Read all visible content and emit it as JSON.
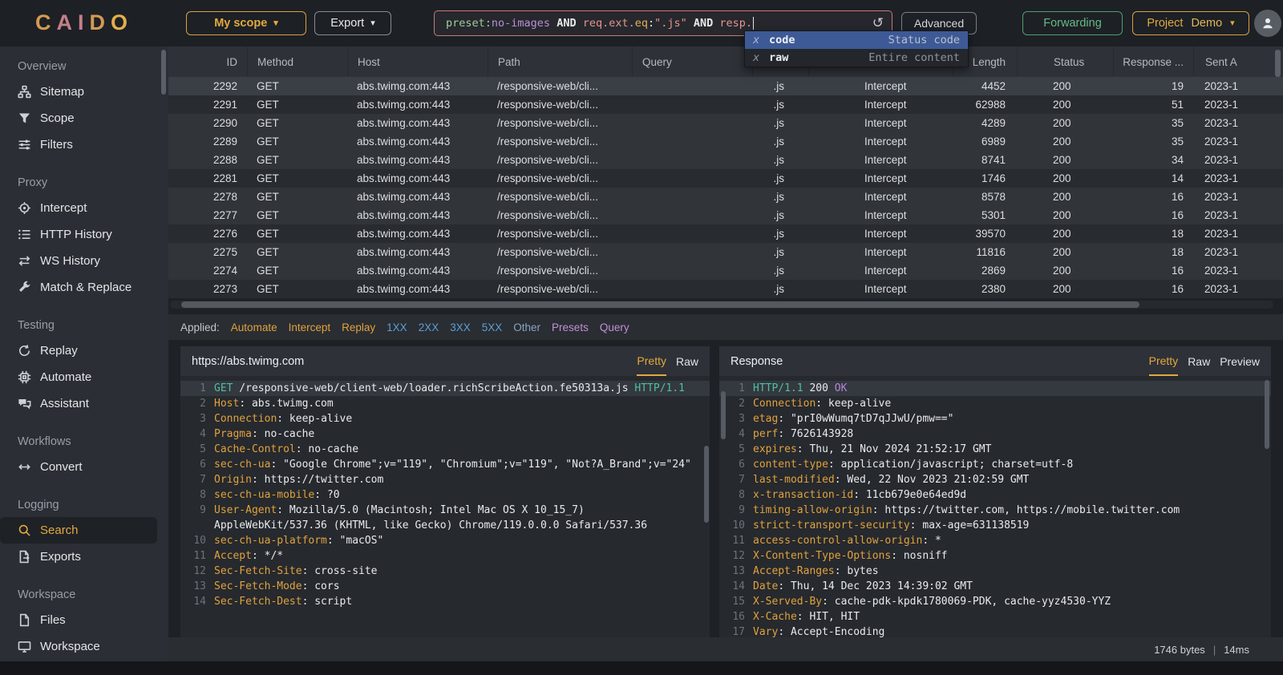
{
  "topbar": {
    "logo_letters": [
      {
        "ch": "C",
        "color": "#d49a52"
      },
      {
        "ch": "A",
        "color": "#c57f88"
      },
      {
        "ch": "I",
        "color": "#c57f88"
      },
      {
        "ch": "D",
        "color": "#d49a52"
      },
      {
        "ch": "O",
        "color": "#e4af49"
      }
    ],
    "scope_button": "My scope",
    "export_button": "Export",
    "search": {
      "segments": [
        {
          "text": "preset:",
          "color": "#9fcf9a"
        },
        {
          "text": "no-images",
          "color": "#b990d8"
        },
        {
          "text": " AND ",
          "color": "#e8e8e8",
          "bold": true
        },
        {
          "text": "req.ext.",
          "color": "#e8938f"
        },
        {
          "text": "eq",
          "color": "#e0b055"
        },
        {
          "text": ":",
          "color": "#e8e8e8"
        },
        {
          "text": "\".js\"",
          "color": "#e8938f"
        },
        {
          "text": " AND ",
          "color": "#e8e8e8",
          "bold": true
        },
        {
          "text": "resp.",
          "color": "#e8938f"
        }
      ],
      "advanced_button": "Advanced"
    },
    "autocomplete": [
      {
        "prefix": "x",
        "label": "code",
        "hint": "Status code",
        "selected": true
      },
      {
        "prefix": "x",
        "label": "raw",
        "hint": "Entire content",
        "selected": false
      }
    ],
    "forwarding_button": "Forwarding",
    "project_label": "Project",
    "project_name": "Demo"
  },
  "sidebar": {
    "sections": [
      {
        "label": "Overview",
        "items": [
          {
            "icon": "sitemap-icon",
            "label": "Sitemap"
          },
          {
            "icon": "funnel-icon",
            "label": "Scope"
          },
          {
            "icon": "sliders-icon",
            "label": "Filters"
          }
        ]
      },
      {
        "label": "Proxy",
        "items": [
          {
            "icon": "target-icon",
            "label": "Intercept"
          },
          {
            "icon": "list-icon",
            "label": "HTTP History"
          },
          {
            "icon": "swap-icon",
            "label": "WS History"
          },
          {
            "icon": "wrench-icon",
            "label": "Match & Replace"
          }
        ]
      },
      {
        "label": "Testing",
        "items": [
          {
            "icon": "refresh-icon",
            "label": "Replay"
          },
          {
            "icon": "chip-icon",
            "label": "Automate"
          },
          {
            "icon": "chat-icon",
            "label": "Assistant"
          }
        ]
      },
      {
        "label": "Workflows",
        "items": [
          {
            "icon": "convert-icon",
            "label": "Convert"
          }
        ]
      },
      {
        "label": "Logging",
        "items": [
          {
            "icon": "search-icon",
            "label": "Search",
            "active": true
          },
          {
            "icon": "export-icon",
            "label": "Exports"
          }
        ]
      },
      {
        "label": "Workspace",
        "items": [
          {
            "icon": "file-icon",
            "label": "Files"
          },
          {
            "icon": "monitor-icon",
            "label": "Workspace"
          }
        ]
      }
    ]
  },
  "table": {
    "columns": [
      "ID",
      "Method",
      "Host",
      "Path",
      "Query",
      "",
      "",
      "Length",
      "Status",
      "Response ...",
      "Sent A"
    ],
    "row_shades": [
      "bright",
      "dark",
      "light",
      "light",
      "light",
      "dark",
      "light",
      "light",
      "dark",
      "light",
      "light",
      "dark"
    ],
    "rows": [
      [
        "2292",
        "GET",
        "abs.twimg.com:443",
        "/responsive-web/cli...",
        "",
        ".js",
        "Intercept",
        "4452",
        "200",
        "19",
        "2023-1"
      ],
      [
        "2291",
        "GET",
        "abs.twimg.com:443",
        "/responsive-web/cli...",
        "",
        ".js",
        "Intercept",
        "62988",
        "200",
        "51",
        "2023-1"
      ],
      [
        "2290",
        "GET",
        "abs.twimg.com:443",
        "/responsive-web/cli...",
        "",
        ".js",
        "Intercept",
        "4289",
        "200",
        "35",
        "2023-1"
      ],
      [
        "2289",
        "GET",
        "abs.twimg.com:443",
        "/responsive-web/cli...",
        "",
        ".js",
        "Intercept",
        "6989",
        "200",
        "35",
        "2023-1"
      ],
      [
        "2288",
        "GET",
        "abs.twimg.com:443",
        "/responsive-web/cli...",
        "",
        ".js",
        "Intercept",
        "8741",
        "200",
        "34",
        "2023-1"
      ],
      [
        "2281",
        "GET",
        "abs.twimg.com:443",
        "/responsive-web/cli...",
        "",
        ".js",
        "Intercept",
        "1746",
        "200",
        "14",
        "2023-1"
      ],
      [
        "2278",
        "GET",
        "abs.twimg.com:443",
        "/responsive-web/cli...",
        "",
        ".js",
        "Intercept",
        "8578",
        "200",
        "16",
        "2023-1"
      ],
      [
        "2277",
        "GET",
        "abs.twimg.com:443",
        "/responsive-web/cli...",
        "",
        ".js",
        "Intercept",
        "5301",
        "200",
        "16",
        "2023-1"
      ],
      [
        "2276",
        "GET",
        "abs.twimg.com:443",
        "/responsive-web/cli...",
        "",
        ".js",
        "Intercept",
        "39570",
        "200",
        "18",
        "2023-1"
      ],
      [
        "2275",
        "GET",
        "abs.twimg.com:443",
        "/responsive-web/cli...",
        "",
        ".js",
        "Intercept",
        "11816",
        "200",
        "18",
        "2023-1"
      ],
      [
        "2274",
        "GET",
        "abs.twimg.com:443",
        "/responsive-web/cli...",
        "",
        ".js",
        "Intercept",
        "2869",
        "200",
        "16",
        "2023-1"
      ],
      [
        "2273",
        "GET",
        "abs.twimg.com:443",
        "/responsive-web/cli...",
        "",
        ".js",
        "Intercept",
        "2380",
        "200",
        "16",
        "2023-1"
      ]
    ]
  },
  "applied": {
    "label": "Applied:",
    "chips": [
      {
        "label": "Automate",
        "color": "#e0a23c"
      },
      {
        "label": "Intercept",
        "color": "#e0a23c"
      },
      {
        "label": "Replay",
        "color": "#e0a23c"
      },
      {
        "label": "1XX",
        "color": "#5b9fd8"
      },
      {
        "label": "2XX",
        "color": "#5b9fd8"
      },
      {
        "label": "3XX",
        "color": "#5b9fd8"
      },
      {
        "label": "5XX",
        "color": "#5b9fd8"
      },
      {
        "label": "Other",
        "color": "#87a5c2"
      },
      {
        "label": "Presets",
        "color": "#c08fd8"
      },
      {
        "label": "Query",
        "color": "#c08fd8"
      }
    ]
  },
  "request_panel": {
    "title": "https://abs.twimg.com",
    "tabs": [
      {
        "label": "Pretty",
        "active": true
      },
      {
        "label": "Raw",
        "active": false
      }
    ],
    "lines": [
      {
        "n": 1,
        "hl": true,
        "seg": [
          [
            "p",
            "GET"
          ],
          [
            "v",
            " /responsive-web/client-web/loader.richScribeAction.fe50313a.js "
          ],
          [
            "p",
            "HTTP/1.1"
          ]
        ]
      },
      {
        "n": 2,
        "seg": [
          [
            "k",
            "Host"
          ],
          [
            "v",
            ": abs.twimg.com"
          ]
        ]
      },
      {
        "n": 3,
        "seg": [
          [
            "k",
            "Connection"
          ],
          [
            "v",
            ": keep-alive"
          ]
        ]
      },
      {
        "n": 4,
        "seg": [
          [
            "k",
            "Pragma"
          ],
          [
            "v",
            ": no-cache"
          ]
        ]
      },
      {
        "n": 5,
        "seg": [
          [
            "k",
            "Cache-Control"
          ],
          [
            "v",
            ": no-cache"
          ]
        ]
      },
      {
        "n": 6,
        "seg": [
          [
            "k",
            "sec-ch-ua"
          ],
          [
            "v",
            ": \"Google Chrome\";v=\"119\", \"Chromium\";v=\"119\", \"Not?A_Brand\";v=\"24\""
          ]
        ]
      },
      {
        "n": 7,
        "seg": [
          [
            "k",
            "Origin"
          ],
          [
            "v",
            ": https://twitter.com"
          ]
        ]
      },
      {
        "n": 8,
        "seg": [
          [
            "k",
            "sec-ch-ua-mobile"
          ],
          [
            "v",
            ": ?0"
          ]
        ]
      },
      {
        "n": 9,
        "seg": [
          [
            "k",
            "User-Agent"
          ],
          [
            "v",
            ": Mozilla/5.0 (Macintosh; Intel Mac OS X 10_15_7) AppleWebKit/537.36 (KHTML, like Gecko) Chrome/119.0.0.0 Safari/537.36"
          ]
        ]
      },
      {
        "n": 10,
        "seg": [
          [
            "k",
            "sec-ch-ua-platform"
          ],
          [
            "v",
            ": \"macOS\""
          ]
        ]
      },
      {
        "n": 11,
        "seg": [
          [
            "k",
            "Accept"
          ],
          [
            "v",
            ": */*"
          ]
        ]
      },
      {
        "n": 12,
        "seg": [
          [
            "k",
            "Sec-Fetch-Site"
          ],
          [
            "v",
            ": cross-site"
          ]
        ]
      },
      {
        "n": 13,
        "seg": [
          [
            "k",
            "Sec-Fetch-Mode"
          ],
          [
            "v",
            ": cors"
          ]
        ]
      },
      {
        "n": 14,
        "seg": [
          [
            "k",
            "Sec-Fetch-Dest"
          ],
          [
            "v",
            ": script"
          ]
        ]
      }
    ]
  },
  "response_panel": {
    "title": "Response",
    "tabs": [
      {
        "label": "Pretty",
        "active": true
      },
      {
        "label": "Raw",
        "active": false
      },
      {
        "label": "Preview",
        "active": false
      }
    ],
    "lines": [
      {
        "n": 1,
        "hl": true,
        "seg": [
          [
            "p",
            "HTTP/1.1"
          ],
          [
            "v",
            " 200 "
          ],
          [
            "s",
            "OK"
          ]
        ]
      },
      {
        "n": 2,
        "seg": [
          [
            "k",
            "Connection"
          ],
          [
            "v",
            ": keep-alive"
          ]
        ]
      },
      {
        "n": 3,
        "seg": [
          [
            "k",
            "etag"
          ],
          [
            "v",
            ": \"prI0wWumq7tD7qJJwU/pmw==\""
          ]
        ]
      },
      {
        "n": 4,
        "seg": [
          [
            "k",
            "perf"
          ],
          [
            "v",
            ": 7626143928"
          ]
        ]
      },
      {
        "n": 5,
        "seg": [
          [
            "k",
            "expires"
          ],
          [
            "v",
            ": Thu, 21 Nov 2024 21:52:17 GMT"
          ]
        ]
      },
      {
        "n": 6,
        "seg": [
          [
            "k",
            "content-type"
          ],
          [
            "v",
            ": application/javascript; charset=utf-8"
          ]
        ]
      },
      {
        "n": 7,
        "seg": [
          [
            "k",
            "last-modified"
          ],
          [
            "v",
            ": Wed, 22 Nov 2023 21:02:59 GMT"
          ]
        ]
      },
      {
        "n": 8,
        "seg": [
          [
            "k",
            "x-transaction-id"
          ],
          [
            "v",
            ": 11cb679e0e64ed9d"
          ]
        ]
      },
      {
        "n": 9,
        "seg": [
          [
            "k",
            "timing-allow-origin"
          ],
          [
            "v",
            ": https://twitter.com, https://mobile.twitter.com"
          ]
        ]
      },
      {
        "n": 10,
        "seg": [
          [
            "k",
            "strict-transport-security"
          ],
          [
            "v",
            ": max-age=631138519"
          ]
        ]
      },
      {
        "n": 11,
        "seg": [
          [
            "k",
            "access-control-allow-origin"
          ],
          [
            "v",
            ": *"
          ]
        ]
      },
      {
        "n": 12,
        "seg": [
          [
            "k",
            "X-Content-Type-Options"
          ],
          [
            "v",
            ": nosniff"
          ]
        ]
      },
      {
        "n": 13,
        "seg": [
          [
            "k",
            "Accept-Ranges"
          ],
          [
            "v",
            ": bytes"
          ]
        ]
      },
      {
        "n": 14,
        "seg": [
          [
            "k",
            "Date"
          ],
          [
            "v",
            ": Thu, 14 Dec 2023 14:39:02 GMT"
          ]
        ]
      },
      {
        "n": 15,
        "seg": [
          [
            "k",
            "X-Served-By"
          ],
          [
            "v",
            ": cache-pdk-kpdk1780069-PDK, cache-yyz4530-YYZ"
          ]
        ]
      },
      {
        "n": 16,
        "seg": [
          [
            "k",
            "X-Cache"
          ],
          [
            "v",
            ": HIT, HIT"
          ]
        ]
      },
      {
        "n": 17,
        "seg": [
          [
            "k",
            "Vary"
          ],
          [
            "v",
            ": Accept-Encoding"
          ]
        ]
      }
    ]
  },
  "footer": {
    "size": "1746 bytes",
    "divider": "|",
    "time": "14ms"
  }
}
